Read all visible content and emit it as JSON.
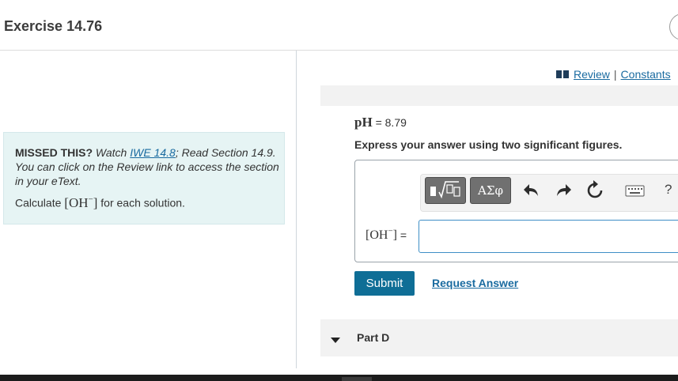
{
  "header": {
    "title": "Exercise 14.76"
  },
  "hint": {
    "missed_label": "MISSED THIS?",
    "watch_text": "Watch",
    "link_text": "IWE 14.8",
    "after_link": "; Read Section 14.9. You can click on the Review link to access the section in your eText.",
    "calculate_prefix": "Calculate",
    "calc_species": "OH",
    "calc_charge": "−",
    "calculate_suffix": "for each solution."
  },
  "review_links": {
    "review": "Review",
    "separator": "|",
    "constants": "Constants"
  },
  "problem": {
    "ph_symbol": "pH",
    "ph_value": "= 8.79",
    "instruction": "Express your answer using two significant figures."
  },
  "answer": {
    "label_species": "OH",
    "label_charge": "−",
    "label_equals": "=",
    "input_value": ""
  },
  "toolbar": {
    "symbols_label": "ΑΣφ",
    "help_label": "?"
  },
  "actions": {
    "submit_label": "Submit",
    "request_label": "Request Answer"
  },
  "next_part": {
    "label": "Part D"
  },
  "colors": {
    "accent": "#0f6e96",
    "link": "#1a6ba0",
    "hint_bg": "#e6f4f4"
  },
  "icons": {
    "book": "book-icon",
    "undo": "undo-icon",
    "redo": "redo-icon",
    "reset": "reset-icon",
    "keyboard": "keyboard-icon",
    "caret": "caret-down-icon",
    "templates": "templates-icon"
  }
}
